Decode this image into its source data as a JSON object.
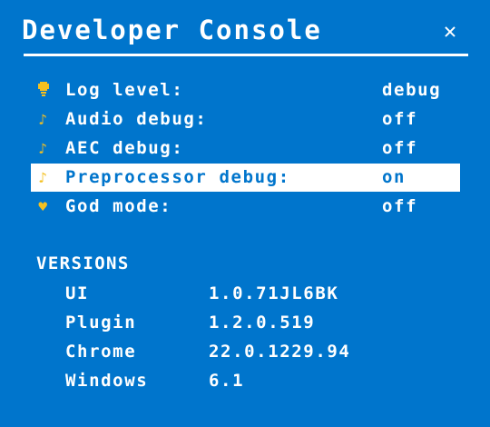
{
  "header": {
    "title": "Developer Console",
    "close_icon": "close-icon",
    "close_glyph": "✕"
  },
  "colors": {
    "background": "#0075cc",
    "text": "#ffffff",
    "icon": "#f4c020",
    "selected_background": "#ffffff",
    "selected_text": "#0075cc"
  },
  "settings": [
    {
      "icon": "lightbulb-icon",
      "glyph": "💡",
      "label": "Log level:",
      "value": "debug",
      "selected": false
    },
    {
      "icon": "music-note-icon",
      "glyph": "♪",
      "label": "Audio debug:",
      "value": "off",
      "selected": false
    },
    {
      "icon": "music-note-icon",
      "glyph": "♪",
      "label": "AEC debug:",
      "value": "off",
      "selected": false
    },
    {
      "icon": "music-note-icon",
      "glyph": "♪",
      "label": "Preprocessor debug:",
      "value": "on",
      "selected": true
    },
    {
      "icon": "heart-icon",
      "glyph": "♥",
      "label": "God mode:",
      "value": "off",
      "selected": false
    }
  ],
  "versions": {
    "heading": "VERSIONS",
    "items": [
      {
        "name": "UI",
        "value": "1.0.71JL6BK"
      },
      {
        "name": "Plugin",
        "value": "1.2.0.519"
      },
      {
        "name": "Chrome",
        "value": "22.0.1229.94"
      },
      {
        "name": "Windows",
        "value": "6.1"
      }
    ]
  }
}
